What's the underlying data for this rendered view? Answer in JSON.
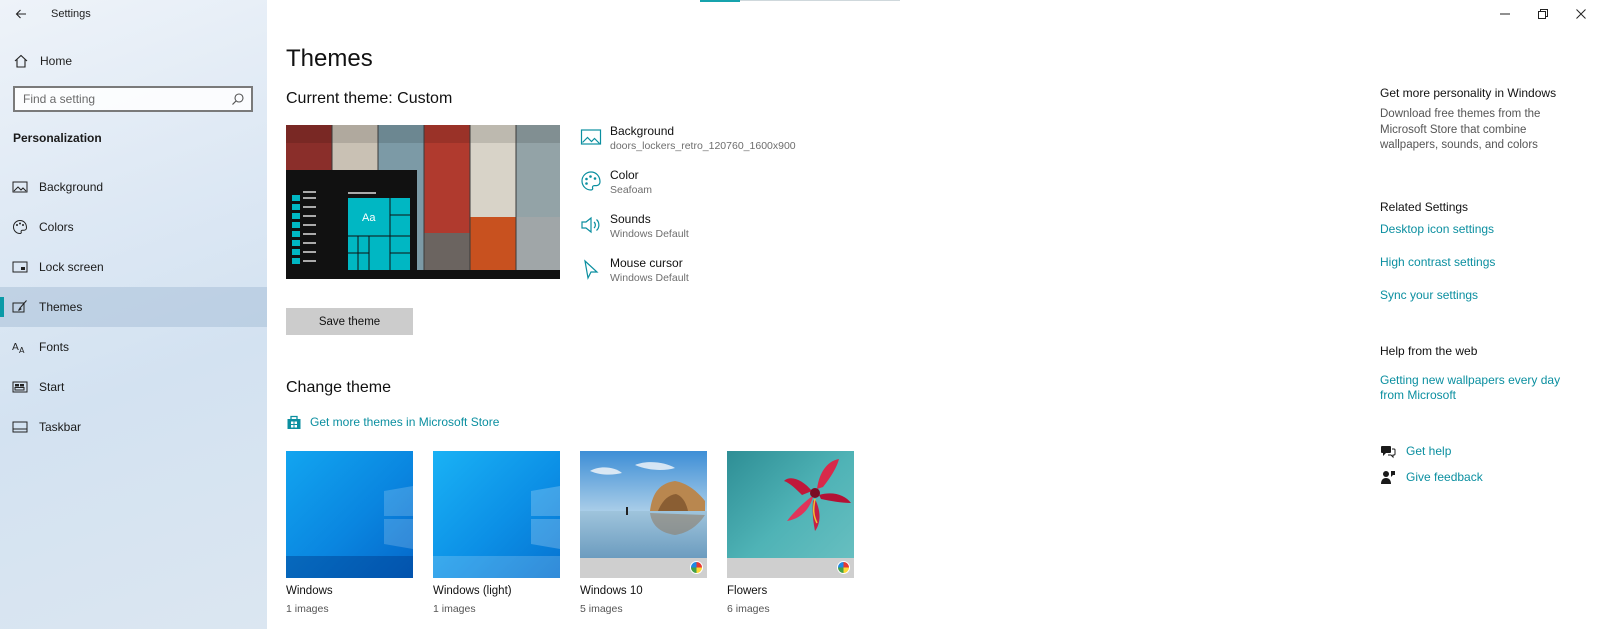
{
  "window": {
    "title": "Settings",
    "controls": {
      "minimize": "minimize",
      "restore": "restore",
      "close": "close"
    }
  },
  "sidebar": {
    "home_label": "Home",
    "search": {
      "placeholder": "Find a setting",
      "value": ""
    },
    "section": "Personalization",
    "items": [
      {
        "label": "Background",
        "icon": "picture-icon",
        "selected": false
      },
      {
        "label": "Colors",
        "icon": "palette-icon",
        "selected": false
      },
      {
        "label": "Lock screen",
        "icon": "lock-screen-icon",
        "selected": false
      },
      {
        "label": "Themes",
        "icon": "brush-icon",
        "selected": true
      },
      {
        "label": "Fonts",
        "icon": "font-icon",
        "selected": false
      },
      {
        "label": "Start",
        "icon": "start-icon",
        "selected": false
      },
      {
        "label": "Taskbar",
        "icon": "taskbar-icon",
        "selected": false
      }
    ]
  },
  "main": {
    "title": "Themes",
    "current_theme": "Current theme: Custom",
    "preview_text": "Aa",
    "settings": [
      {
        "name": "Background",
        "value": "doors_lockers_retro_120760_1600x900"
      },
      {
        "name": "Color",
        "value": "Seafoam"
      },
      {
        "name": "Sounds",
        "value": "Windows Default"
      },
      {
        "name": "Mouse cursor",
        "value": "Windows Default"
      }
    ],
    "save_label": "Save theme",
    "change_theme": "Change theme",
    "store_link": "Get more themes in Microsoft Store",
    "themes": [
      {
        "name": "Windows",
        "count": "1 images"
      },
      {
        "name": "Windows (light)",
        "count": "1 images"
      },
      {
        "name": "Windows 10",
        "count": "5 images"
      },
      {
        "name": "Flowers",
        "count": "6 images"
      }
    ]
  },
  "right_panel": {
    "personality_title": "Get more personality in Windows",
    "personality_text": "Download free themes from the Microsoft Store that combine wallpapers, sounds, and colors",
    "related_title": "Related Settings",
    "related_links": [
      "Desktop icon settings",
      "High contrast settings",
      "Sync your settings"
    ],
    "help_title": "Help from the web",
    "help_link": "Getting new wallpapers every day from Microsoft",
    "get_help": "Get help",
    "give_feedback": "Give feedback"
  },
  "colors": {
    "accent": "#0b8fa0",
    "seafoam": "#00b7c3"
  }
}
